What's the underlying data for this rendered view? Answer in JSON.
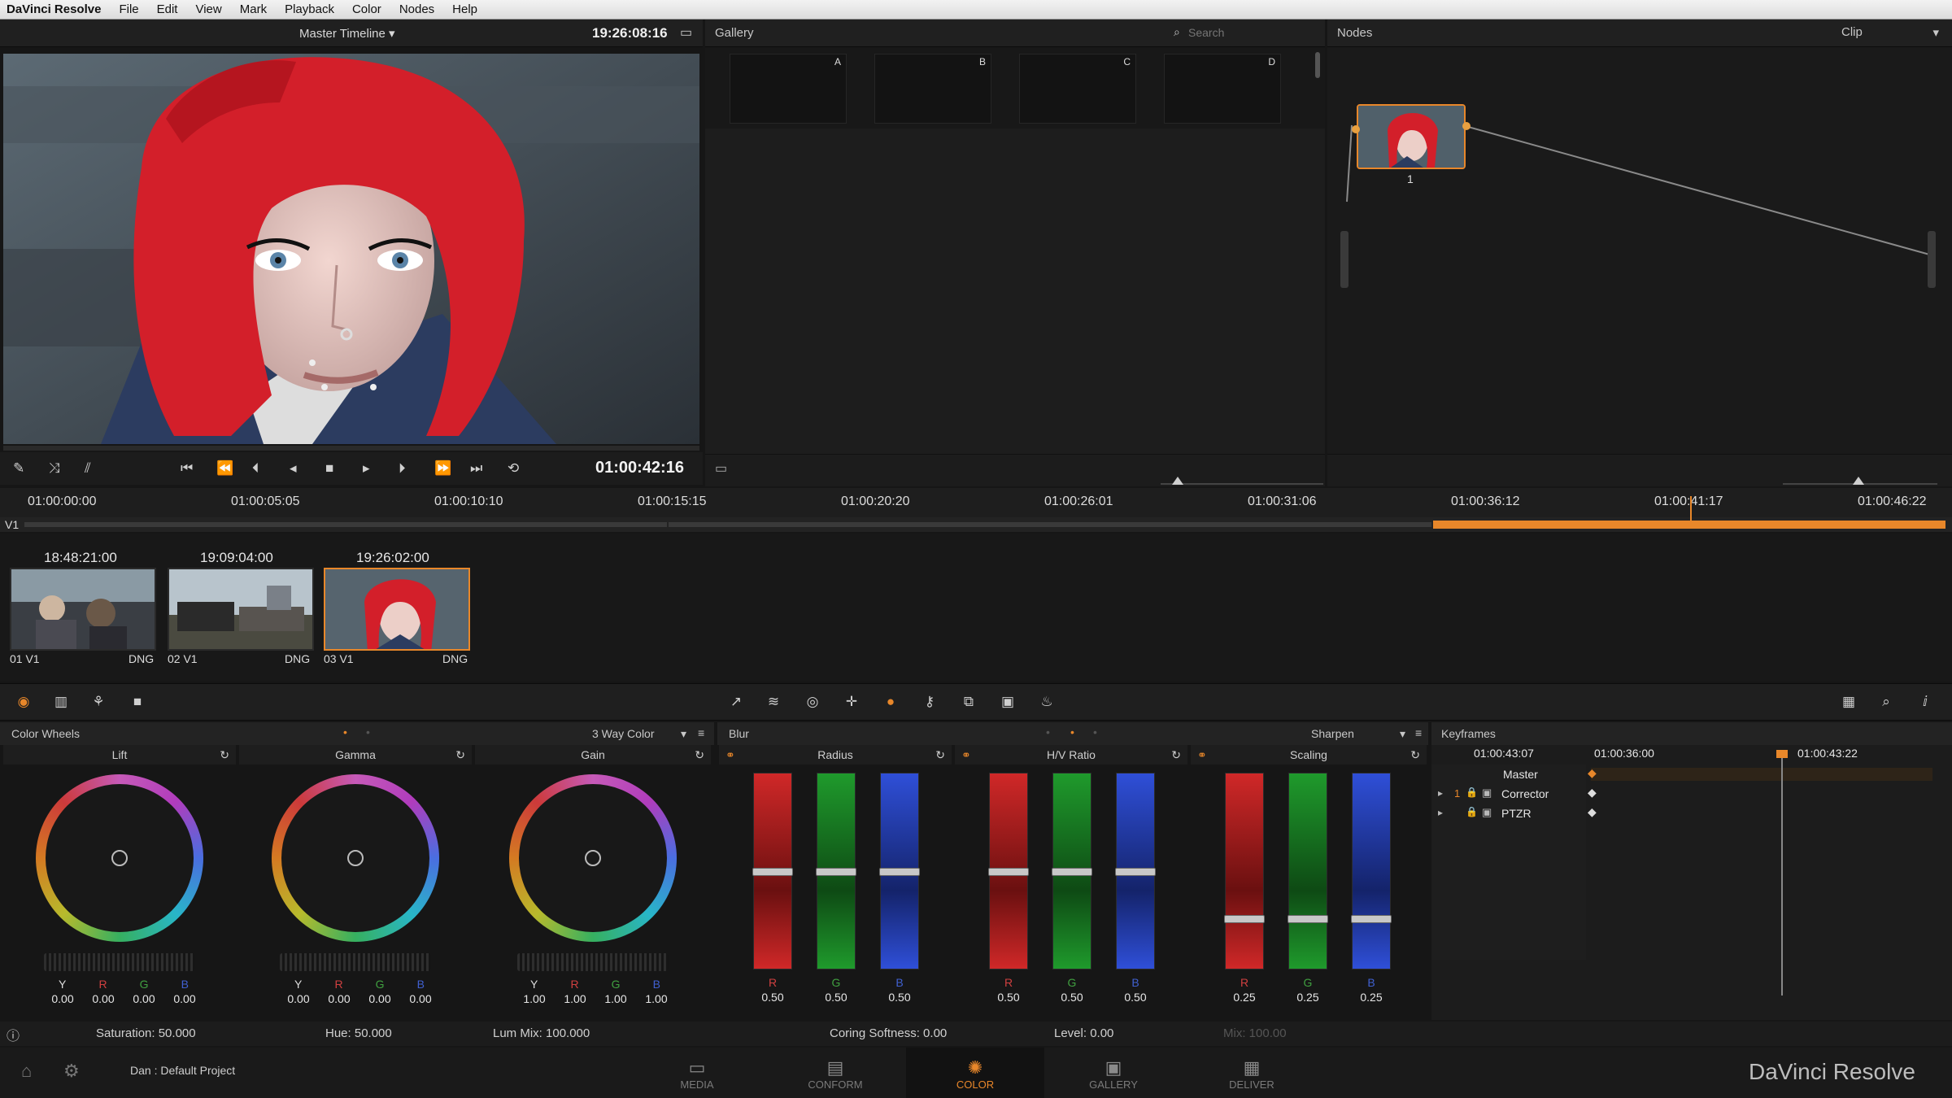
{
  "menubar": {
    "items": [
      "DaVinci Resolve",
      "File",
      "Edit",
      "View",
      "Mark",
      "Playback",
      "Color",
      "Nodes",
      "Help"
    ]
  },
  "viewer": {
    "timeline_name": "Master Timeline",
    "source_tc": "19:26:08:16",
    "record_tc": "01:00:42:16"
  },
  "gallery": {
    "title": "Gallery",
    "search_placeholder": "Search",
    "stills": [
      "A",
      "B",
      "C",
      "D"
    ]
  },
  "nodes": {
    "title": "Nodes",
    "mode": "Clip",
    "node_label": "1"
  },
  "timeline": {
    "ruler": [
      "01:00:00:00",
      "01:00:05:05",
      "01:00:10:10",
      "01:00:15:15",
      "01:00:20:20",
      "01:00:26:01",
      "01:00:31:06",
      "01:00:36:12",
      "01:00:41:17",
      "01:00:46:22"
    ],
    "track": "V1"
  },
  "clips": [
    {
      "tc": "18:48:21:00",
      "label": "01 V1",
      "format": "DNG"
    },
    {
      "tc": "19:09:04:00",
      "label": "02 V1",
      "format": "DNG"
    },
    {
      "tc": "19:26:02:00",
      "label": "03 V1",
      "format": "DNG"
    }
  ],
  "color_wheels": {
    "title": "Color Wheels",
    "mode": "3 Way Color",
    "wheels": [
      {
        "name": "Lift",
        "Y": "0.00",
        "R": "0.00",
        "G": "0.00",
        "B": "0.00"
      },
      {
        "name": "Gamma",
        "Y": "0.00",
        "R": "0.00",
        "G": "0.00",
        "B": "0.00"
      },
      {
        "name": "Gain",
        "Y": "1.00",
        "R": "1.00",
        "G": "1.00",
        "B": "1.00"
      }
    ],
    "saturation": "Saturation: 50.000",
    "hue": "Hue: 50.000",
    "lum_mix": "Lum Mix: 100.000"
  },
  "channel_letters": [
    "Y",
    "R",
    "G",
    "B"
  ],
  "blur": {
    "title": "Blur",
    "mode": "Sharpen",
    "groups": [
      {
        "name": "Radius",
        "values": [
          "0.50",
          "0.50",
          "0.50"
        ],
        "level": 0.5
      },
      {
        "name": "H/V Ratio",
        "values": [
          "0.50",
          "0.50",
          "0.50"
        ],
        "level": 0.5
      },
      {
        "name": "Scaling",
        "values": [
          "0.25",
          "0.25",
          "0.25"
        ],
        "level": 0.25
      }
    ],
    "rgb": [
      "R",
      "G",
      "B"
    ],
    "coring": "Coring Softness: 0.00",
    "level": "Level: 0.00",
    "mix": "Mix: 100.00"
  },
  "keyframes": {
    "title": "Keyframes",
    "tc_current": "01:00:43:07",
    "tc_start": "01:00:36:00",
    "tc_end": "01:00:43:22",
    "tracks": [
      "Master",
      "Corrector",
      "PTZR"
    ],
    "corrector_num": "1"
  },
  "footer": {
    "project": "Dan : Default Project",
    "brand": "DaVinci Resolve",
    "modules": [
      "MEDIA",
      "CONFORM",
      "COLOR",
      "GALLERY",
      "DELIVER"
    ]
  },
  "colors": {
    "accent": "#e8872a",
    "selected_module": "#e8872a"
  }
}
